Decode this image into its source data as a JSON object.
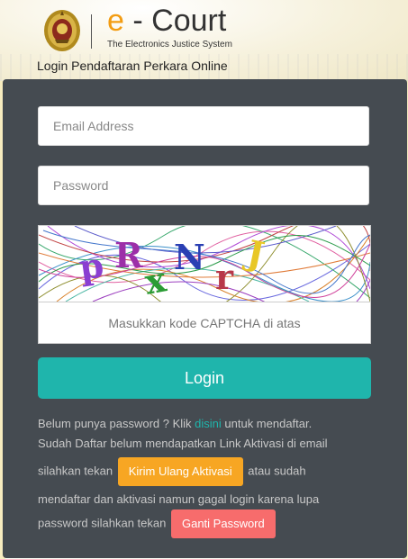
{
  "header": {
    "brand_e": "e",
    "brand_dash": " - ",
    "brand_court": "Court",
    "tagline": "The Electronics Justice System",
    "page_title": "Login Pendaftaran Perkara Online"
  },
  "form": {
    "email_placeholder": "Email Address",
    "password_placeholder": "Password",
    "captcha_text": "pRxNrJ",
    "captcha_placeholder": "Masukkan kode CAPTCHA di atas",
    "login_label": "Login"
  },
  "info": {
    "line1_before": "Belum punya password ? Klik ",
    "line1_link": "disini",
    "line1_after": " untuk mendaftar.",
    "line2": "Sudah Daftar belum mendapatkan Link Aktivasi di email",
    "line3_before": "silahkan tekan ",
    "resend_label": "Kirim Ulang Aktivasi",
    "line3_after": " atau sudah",
    "line4": "mendaftar dan aktivasi namun gagal login karena lupa",
    "line5_before": "password silahkan tekan ",
    "reset_label": "Ganti Password"
  },
  "colors": {
    "accent": "#1fb5ac",
    "brand_orange": "#f39c12",
    "resend_button": "#f7a623",
    "reset_button": "#f76c6c",
    "panel": "#454b51"
  }
}
